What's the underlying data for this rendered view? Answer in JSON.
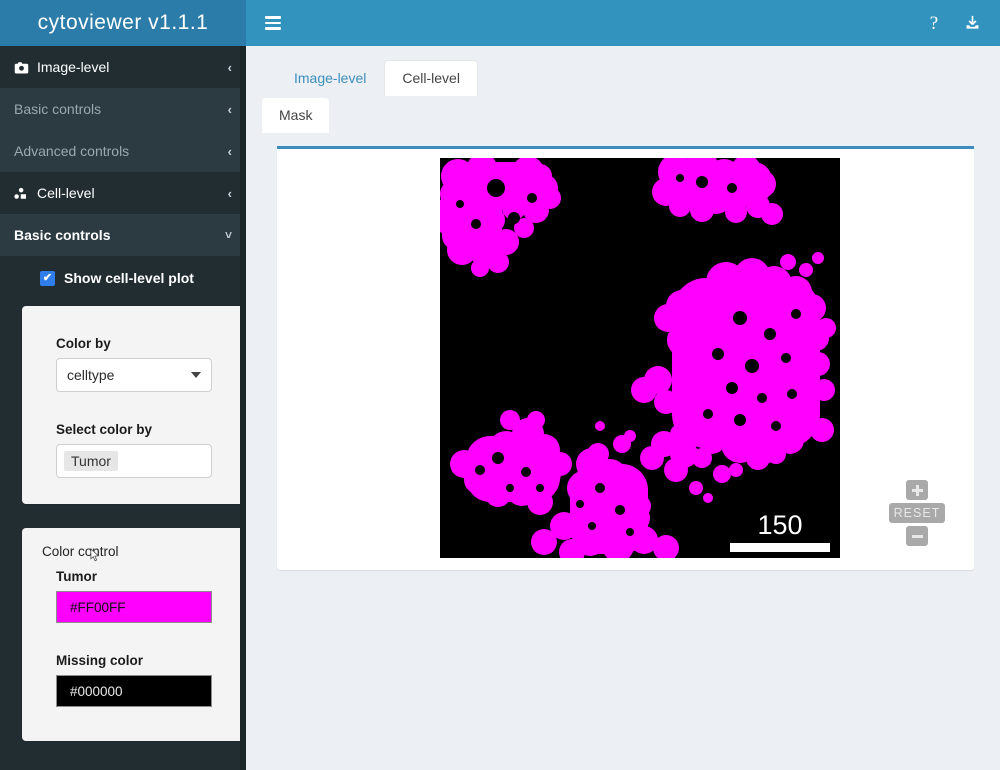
{
  "app": {
    "brand": "cytoviewer v1.1.1"
  },
  "navbar": {
    "menu_icon": "hamburger-icon",
    "help_icon": "?",
    "download_icon": "download-icon"
  },
  "sidebar": {
    "items": [
      {
        "label": "Image-level",
        "icon": "camera-icon",
        "chevron": "‹",
        "level": 1
      },
      {
        "label": "Basic controls",
        "chevron": "‹",
        "level": 2
      },
      {
        "label": "Advanced controls",
        "chevron": "‹",
        "level": 2
      },
      {
        "label": "Cell-level",
        "icon": "shapes-icon",
        "chevron": "‹",
        "level": 1
      },
      {
        "label": "Basic controls",
        "chevron": "˅",
        "level": 2,
        "active": true
      }
    ],
    "checkbox": {
      "label": "Show cell-level plot",
      "checked": true,
      "mark": "✔"
    },
    "basic_panel": {
      "color_by_label": "Color by",
      "color_by_value": "celltype",
      "select_color_by_label": "Select color by",
      "select_color_by_tag": "Tumor"
    },
    "color_control": {
      "title": "Color control",
      "entries": [
        {
          "label": "Tumor",
          "value": "#FF00FF",
          "swatch": "#FF00FF"
        },
        {
          "label": "Missing color",
          "value": "#000000",
          "swatch": "#000000"
        }
      ]
    }
  },
  "content": {
    "tabs": [
      {
        "label": "Image-level",
        "active": false
      },
      {
        "label": "Cell-level",
        "active": true
      }
    ],
    "subtabs": [
      {
        "label": "Mask",
        "active": true
      }
    ],
    "viewer": {
      "scalebar_value": "150",
      "zoom_in": "+",
      "zoom_reset": "RESET",
      "zoom_out": "−",
      "mask_color": "#FF00FF",
      "background_color": "#000000"
    }
  }
}
